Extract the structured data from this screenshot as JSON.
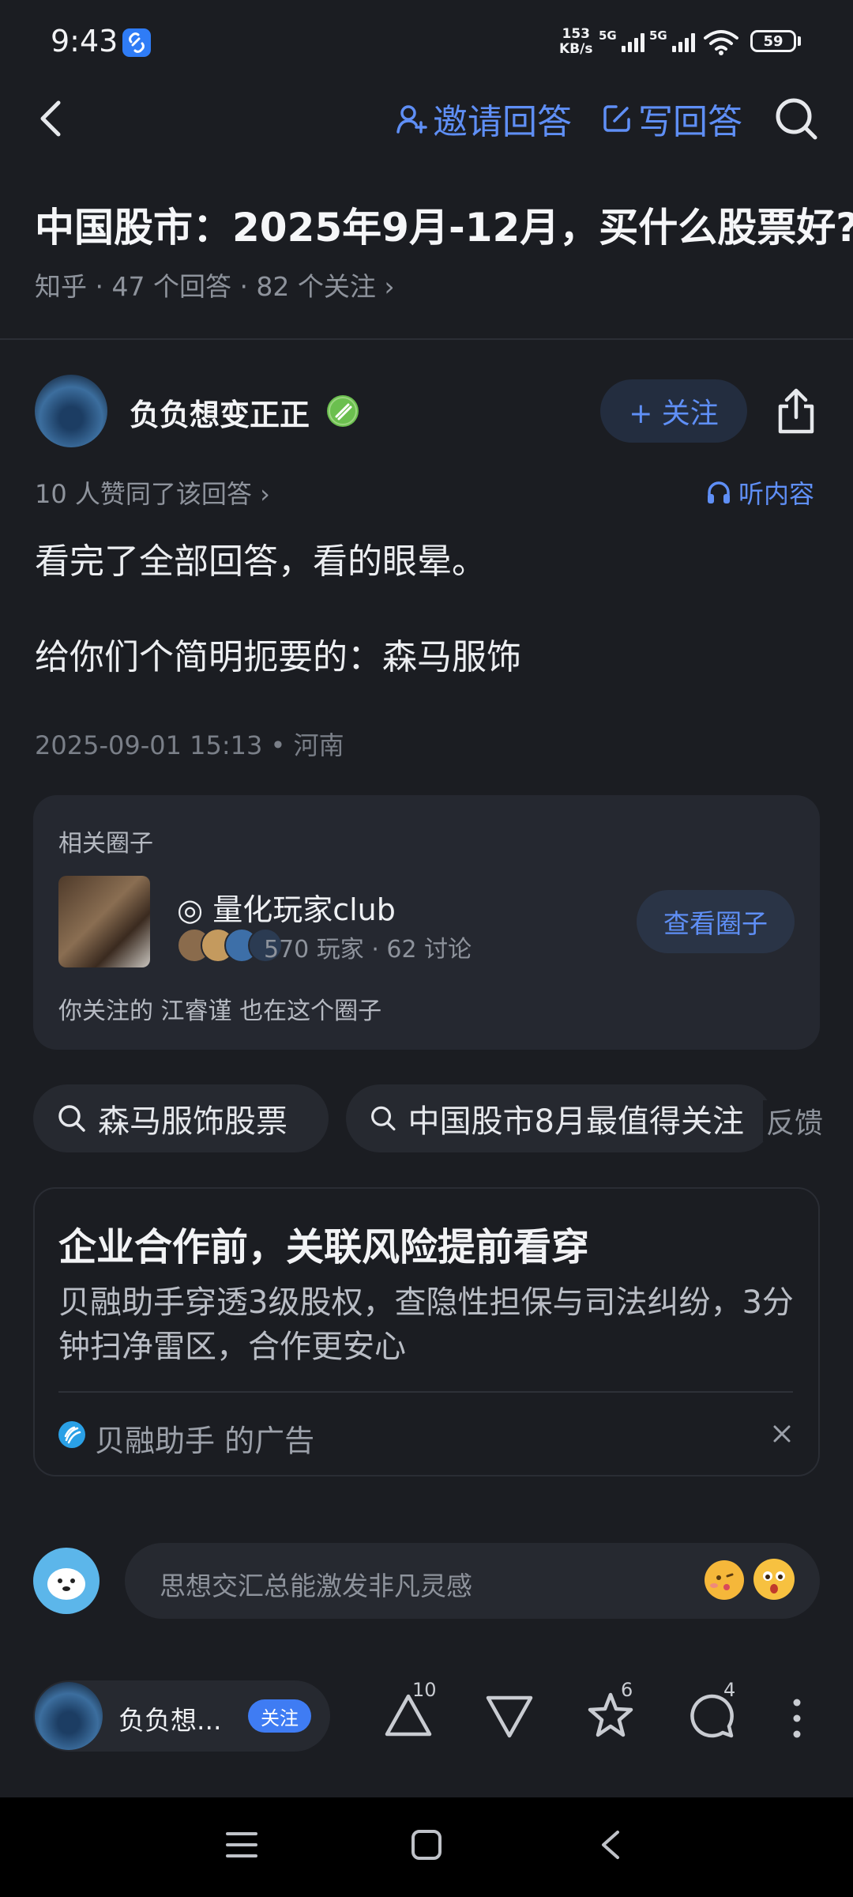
{
  "status_bar": {
    "time": "9:43",
    "net_speed_value": "153",
    "net_speed_unit": "KB/s",
    "sig1_label": "5G",
    "sig2_label": "5G",
    "battery": "59"
  },
  "nav": {
    "invite_label": "邀请回答",
    "write_label": "写回答"
  },
  "question": {
    "title": "中国股市：2025年9月-12月，买什么股票好?",
    "meta": "知乎 · 47 个回答 · 82 个关注 ›"
  },
  "answer": {
    "author_name": "负负想变正正",
    "follow_label": "+ 关注",
    "likes_text": "10 人赞同了该回答 ›",
    "listen_label": "听内容",
    "paragraph_1": "看完了全部回答，看的眼晕。",
    "paragraph_2": "给你们个简明扼要的：森马服饰",
    "posted": "2025-09-01 15:13 • 河南"
  },
  "circle": {
    "header": "相关圈子",
    "name": "◎ 量化玩家club",
    "stats": "570 玩家 · 62 讨论",
    "view_label": "查看圈子",
    "footer": "你关注的 江睿谨 也在这个圈子"
  },
  "search_chips": [
    {
      "label": "森马服饰股票"
    },
    {
      "label": "中国股市8月最值得关注"
    }
  ],
  "feedback_label": "反馈",
  "ad": {
    "title": "企业合作前，关联风险提前看穿",
    "description": "贝融助手穿透3级股权，查隐性担保与司法纠纷，3分钟扫净雷区，合作更安心",
    "source": "贝融助手 的广告"
  },
  "comment": {
    "placeholder": "思想交汇总能激发非凡灵感"
  },
  "bottom_bar": {
    "author_short": "负负想...",
    "follow_label": "关注",
    "upvote_count": "10",
    "favorite_count": "6",
    "comment_count": "4"
  },
  "colors": {
    "background": "#1b1d22",
    "accent": "#5f8ff6",
    "card": "#252830"
  }
}
